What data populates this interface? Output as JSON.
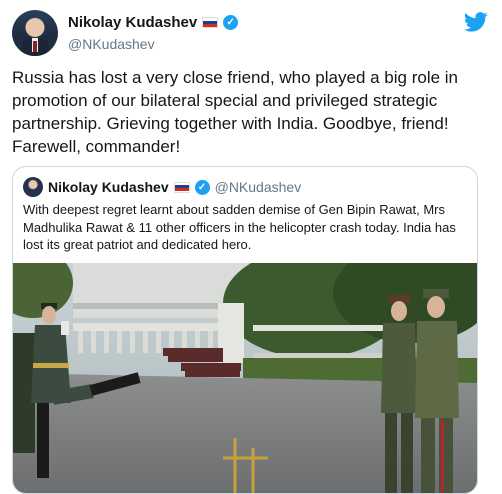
{
  "tweet": {
    "author_name": "Nikolay Kudashev",
    "author_handle": "@NKudashev",
    "text": "Russia has lost a very close friend, who played a big role in promotion of our bilateral special and privileged strategic partnership. Grieving together with India. Goodbye, friend! Farewell, commander!"
  },
  "quoted_tweet": {
    "author_name": "Nikolay Kudashev",
    "author_handle": "@NKudashev",
    "text": "With deepest regret learnt about sadden demise of Gen Bipin Rawat, Mrs Madhulika Rawat & 11 other officers in the helicopter crash today. India has lost its great patriot and dedicated hero."
  },
  "colors": {
    "accent": "#1da1f2",
    "text": "#14171a",
    "muted": "#657786",
    "border": "#ccd6dd"
  },
  "icons": [
    "verified-badge-icon",
    "russia-flag-icon",
    "twitter-bird-icon"
  ]
}
